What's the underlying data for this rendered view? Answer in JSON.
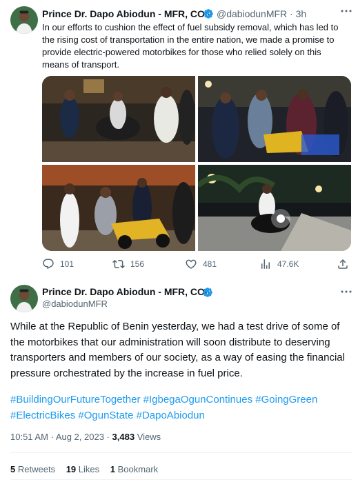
{
  "tweet1": {
    "author_name": "Prince Dr. Dapo Abiodun - MFR, CON",
    "handle": "@dabiodunMFR",
    "separator": "·",
    "time": "3h",
    "text": "In our efforts to cushion the effect of fuel subsidy removal, which has led to the rising cost of transportation in the entire nation, we made a promise to provide electric-powered motorbikes for those who relied solely on this means of transport.",
    "media": [
      {
        "icon": "photo-men-on-motorbike-night"
      },
      {
        "icon": "photo-men-inspecting-yellow-motorbike"
      },
      {
        "icon": "photo-man-seated-on-yellow-motorbike"
      },
      {
        "icon": "photo-rider-on-motorbike-headlight"
      }
    ],
    "actions": {
      "replies": "101",
      "retweets": "156",
      "likes": "481",
      "views": "47.6K"
    }
  },
  "tweet2": {
    "author_name": "Prince Dr. Dapo Abiodun - MFR, CON",
    "handle": "@dabiodunMFR",
    "text": "While at the Republic of Benin yesterday, we had a test drive of some of the motorbikes that our administration will soon distribute to deserving transporters and members of our society, as a way of easing the financial pressure orchestrated by the increase in fuel price.",
    "hashtags": [
      "#BuildingOurFutureTogether",
      "#IgbegaOgunContinues",
      "#GoingGreen",
      "#ElectricBikes",
      "#OgunState",
      "#DapoAbiodun"
    ],
    "time": "10:51 AM",
    "date": "Aug 2, 2023",
    "meta_separator": "·",
    "views_count": "3,483",
    "views_label": "Views",
    "stats": {
      "retweets_count": "5",
      "retweets_label": "Retweets",
      "likes_count": "19",
      "likes_label": "Likes",
      "bookmarks_count": "1",
      "bookmarks_label": "Bookmark"
    }
  },
  "colors": {
    "accent": "#1d9bf0",
    "text": "#0f1419",
    "muted": "#536471",
    "divider": "#eff3f4"
  }
}
